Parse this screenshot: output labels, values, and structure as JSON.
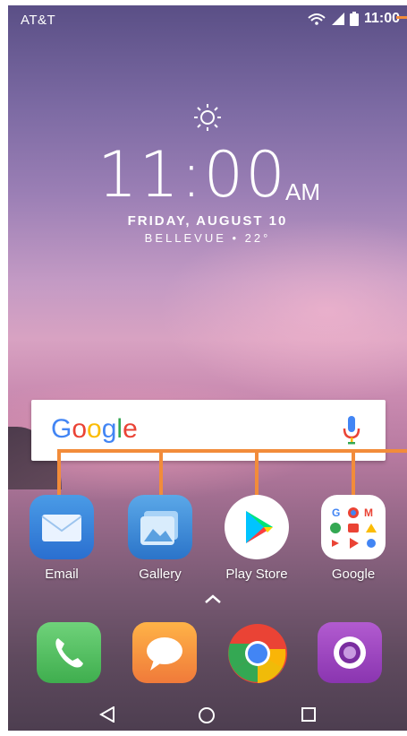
{
  "status_bar": {
    "carrier": "AT&T",
    "time": "11:00"
  },
  "clock_widget": {
    "time": "11:00",
    "ampm": "AM",
    "date": "FRIDAY, AUGUST 10",
    "location_weather": "BELLEVUE • 22°",
    "weather_icon": "sun-icon"
  },
  "search": {
    "logo": "Google",
    "mic_icon": "mic-icon"
  },
  "apps": [
    {
      "label": "Email",
      "icon": "email-icon"
    },
    {
      "label": "Gallery",
      "icon": "gallery-icon"
    },
    {
      "label": "Play Store",
      "icon": "play-store-icon"
    },
    {
      "label": "Google",
      "icon": "google-folder-icon"
    }
  ],
  "dock": [
    {
      "icon": "phone-icon"
    },
    {
      "icon": "messages-icon"
    },
    {
      "icon": "chrome-icon"
    },
    {
      "icon": "camera-icon"
    }
  ],
  "nav": [
    {
      "icon": "back-icon"
    },
    {
      "icon": "home-icon"
    },
    {
      "icon": "recents-icon"
    }
  ],
  "colors": {
    "callout": "#f28c3a"
  }
}
